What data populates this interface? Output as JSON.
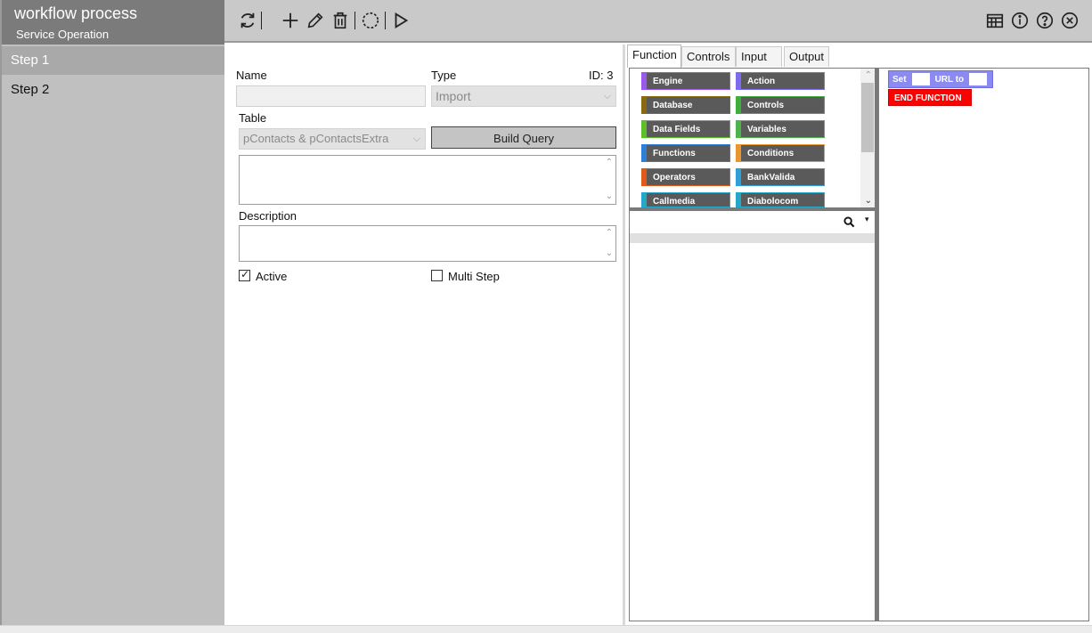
{
  "app": {
    "title": "workflow process",
    "subtitle": "Service Operation"
  },
  "sidebar": {
    "steps": [
      {
        "label": "Step 1"
      },
      {
        "label": "Step 2"
      }
    ]
  },
  "toolbar": {
    "left_icons": [
      "refresh-icon",
      "add-icon",
      "edit-icon",
      "delete-icon",
      "circle-dashed-icon",
      "play-icon"
    ],
    "right_icons": [
      "report-icon",
      "info-icon",
      "help-icon",
      "close-icon"
    ]
  },
  "form": {
    "name_label": "Name",
    "name_value": "",
    "type_label": "Type",
    "id_label": "ID: 3",
    "type_value": "Import",
    "table_label": "Table",
    "table_value": "pContacts & pContactsExtra",
    "build_query_label": "Build Query",
    "query_text": "",
    "description_label": "Description",
    "description_value": "",
    "active_label": "Active",
    "active_checked": true,
    "multistep_label": "Multi Step",
    "multistep_checked": false
  },
  "tabs": [
    {
      "label": "Function",
      "active": true
    },
    {
      "label": "Controls",
      "active": false
    },
    {
      "label": "Input",
      "active": false
    },
    {
      "label": "Output",
      "active": false
    }
  ],
  "palette": {
    "categories": [
      {
        "label": "Engine",
        "color": "#9b59f0"
      },
      {
        "label": "Action",
        "color": "#7b6cf2"
      },
      {
        "label": "Database",
        "color": "#8a6a10"
      },
      {
        "label": "Controls",
        "color": "#3fae3f"
      },
      {
        "label": "Data Fields",
        "color": "#5cbf2a"
      },
      {
        "label": "Variables",
        "color": "#4db34d"
      },
      {
        "label": "Functions",
        "color": "#2f7fd9"
      },
      {
        "label": "Conditions",
        "color": "#e8962e"
      },
      {
        "label": "Operators",
        "color": "#e05a1a"
      },
      {
        "label": "BankValida",
        "color": "#2f9fd9"
      },
      {
        "label": "Callmedia",
        "color": "#25a7c9"
      },
      {
        "label": "Diabolocom",
        "color": "#25a7c9"
      }
    ],
    "search_value": ""
  },
  "canvas": {
    "set_block": {
      "set_label": "Set",
      "url_label": "URL to",
      "color": "#8a8af0"
    },
    "end_block": {
      "label": "END FUNCTION",
      "color": "#ff0000"
    }
  }
}
